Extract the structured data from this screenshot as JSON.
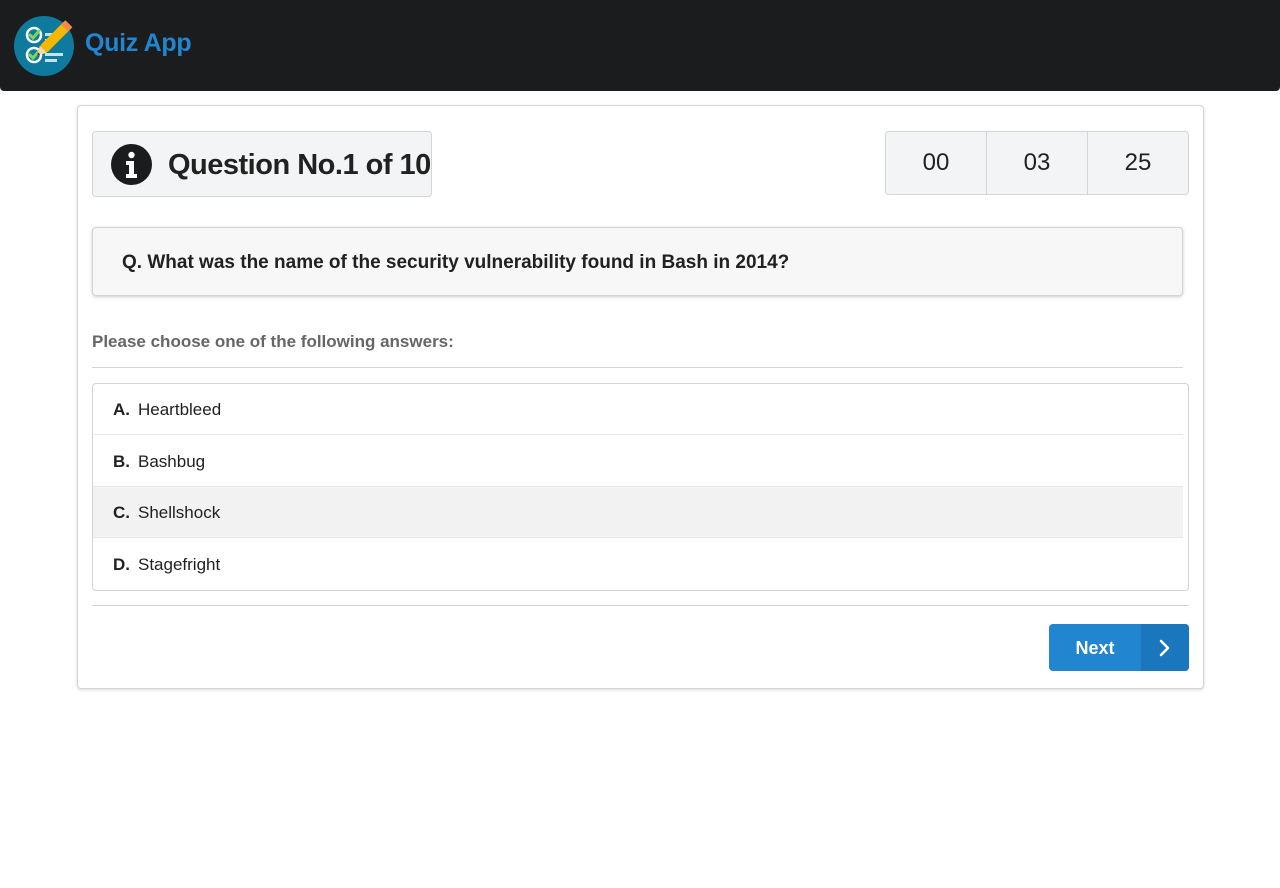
{
  "app": {
    "brand": "Quiz App",
    "brand_color": "#2185d0",
    "logo_icon": "quiz-checklist-pencil-logo"
  },
  "header": {
    "question_number": "Question No.1 of 10",
    "icon": "info-icon"
  },
  "timer": {
    "hours": "00",
    "minutes": "03",
    "seconds": "25"
  },
  "question": {
    "text": "Q. What was the name of the security vulnerability found in Bash in 2014?"
  },
  "prompt": "Please choose one of the following answers:",
  "answers": [
    {
      "letter": "A.",
      "text": "Heartbleed",
      "selected": false
    },
    {
      "letter": "B.",
      "text": "Bashbug",
      "selected": false
    },
    {
      "letter": "C.",
      "text": "Shellshock",
      "selected": true
    },
    {
      "letter": "D.",
      "text": "Stagefright",
      "selected": false
    }
  ],
  "actions": {
    "next_label": "Next",
    "next_icon": "chevron-right-icon"
  }
}
